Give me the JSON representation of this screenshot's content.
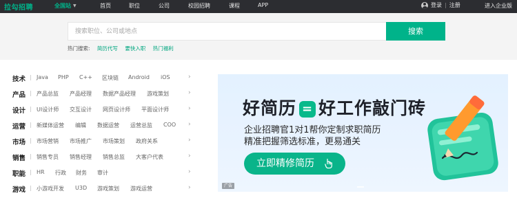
{
  "header": {
    "logo": "拉勾招聘",
    "city": "全国站",
    "nav": [
      "首页",
      "职位",
      "公司",
      "校园招聘",
      "课程",
      "APP"
    ],
    "login": "登录",
    "divider": "|",
    "register": "注册",
    "enterprise": "进入企业版"
  },
  "search": {
    "placeholder": "搜索职位、公司或地点",
    "button": "搜索",
    "hot_label": "热门搜索:",
    "hot_links": [
      "简历代写",
      "要快入职",
      "热门福利"
    ]
  },
  "categories": [
    {
      "title": "技术",
      "items": [
        "Java",
        "PHP",
        "C++",
        "区块链",
        "Android",
        "iOS"
      ]
    },
    {
      "title": "产品",
      "items": [
        "产品总监",
        "产品经理",
        "数据产品经理",
        "游戏策划"
      ]
    },
    {
      "title": "设计",
      "items": [
        "UI设计师",
        "交互设计",
        "网页设计师",
        "平面设计师"
      ]
    },
    {
      "title": "运营",
      "items": [
        "新媒体运营",
        "编辑",
        "数据运营",
        "运营总监",
        "COO"
      ]
    },
    {
      "title": "市场",
      "items": [
        "市场营销",
        "市场推广",
        "市场策划",
        "政府关系"
      ]
    },
    {
      "title": "销售",
      "items": [
        "销售专员",
        "销售经理",
        "销售总监",
        "大客户代表"
      ]
    },
    {
      "title": "职能",
      "items": [
        "HR",
        "行政",
        "财务",
        "审计"
      ]
    },
    {
      "title": "游戏",
      "items": [
        "小游戏开发",
        "U3D",
        "游戏策划",
        "游戏运营"
      ]
    }
  ],
  "banner": {
    "title_left": "好简历",
    "title_symbol": "=",
    "title_right": "好工作敲门砖",
    "line1": "企业招聘官1对1帮你定制求职简历",
    "line2": "精准把握筛选标准，更易通关",
    "cta": "立即精修简历",
    "ad_tag": "广告"
  },
  "colors": {
    "brand_green": "#00b38a",
    "topbar": "#2c2d31",
    "search_band": "#f4f4f4"
  }
}
